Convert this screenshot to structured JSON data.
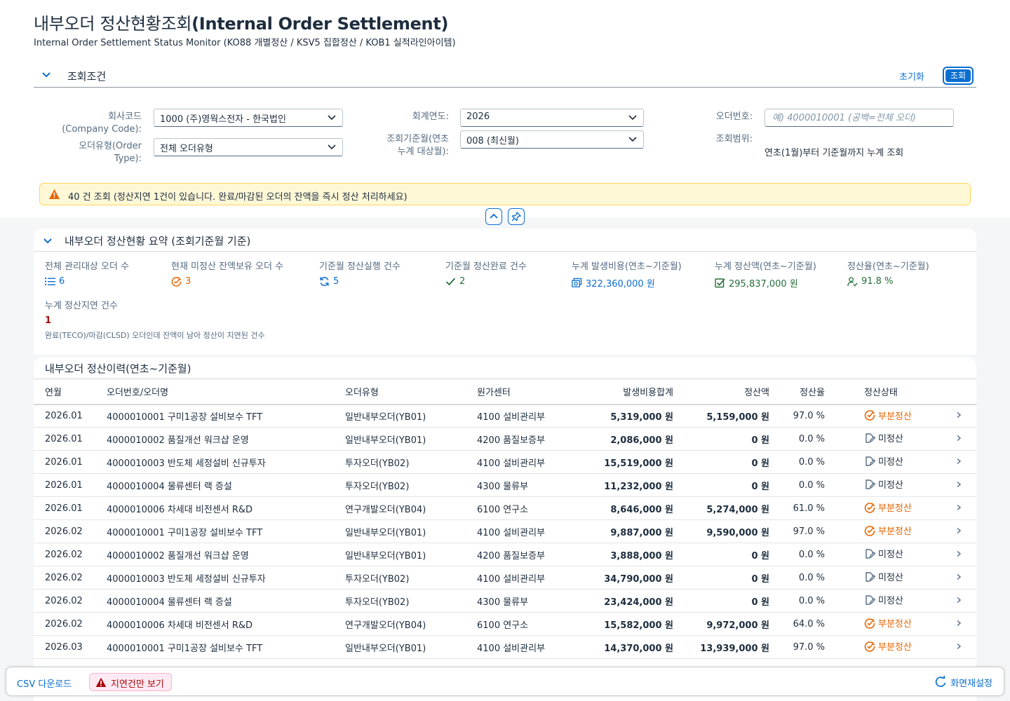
{
  "header": {
    "title_ko": "내부오더 정산현황조회",
    "title_en": "(Internal Order Settlement)",
    "subtitle": "Internal Order Settlement Status Monitor (KO88 개별정산 / KSV5 집합정산 / KOB1 실적라인아이템)"
  },
  "conditions": {
    "title": "조회조건",
    "reset_label": "초기화",
    "search_label": "조회",
    "company_code_label": "회사코드\n(Company Code):",
    "company_code_value": "1000 (주)영웍스전자 - 한국법인",
    "order_type_label": "오더유형(Order\nType):",
    "order_type_value": "전체 오더유형",
    "fiscal_year_label": "회계연도:",
    "fiscal_year_value": "2026",
    "period_label": "조회기준월(연초\n누계 대상월):",
    "period_value": "008 (최신월)",
    "order_no_label": "오더번호:",
    "order_no_placeholder": "예) 4000010001 (공백=전체 오더)",
    "scope_label": "조회범위:",
    "scope_value": "연초(1월)부터 기준월까지 누계 조회"
  },
  "message": {
    "text": "40 건 조회 (정산지연 1건이 있습니다. 완료/마감된 오더의 잔액을 즉시 정산 처리하세요)"
  },
  "summary": {
    "title": "내부오더 정산현황 요약 (조회기준월 기준)",
    "kpis": [
      {
        "label": "전체 관리대상 오더 수",
        "value": "6",
        "icon": "list-icon",
        "color": "#0a6ed1"
      },
      {
        "label": "현재 미정산 잔액보유 오더 수",
        "value": "3",
        "icon": "partial-settle-icon",
        "color": "#e76500"
      },
      {
        "label": "기준월 정산실행 건수",
        "value": "5",
        "icon": "refresh-icon",
        "color": "#0a6ed1"
      },
      {
        "label": "기준월 정산완료 건수",
        "value": "2",
        "icon": "check-icon",
        "color": "#256f3a"
      },
      {
        "label": "누계 발생비용(연초~기준월)",
        "value": "322,360,000 원",
        "icon": "money-icon",
        "color": "#0a6ed1"
      },
      {
        "label": "누계 정산액(연초~기준월)",
        "value": "295,837,000 원",
        "icon": "checkbox-icon",
        "color": "#256f3a"
      },
      {
        "label": "정산율(연초~기준월)",
        "value": "91.8 %",
        "icon": "person-check-icon",
        "color": "#256f3a"
      }
    ],
    "delay": {
      "label": "누계 정산지연 건수",
      "value": "1",
      "note": "완료(TECO)/마감(CLSD) 오더인데 잔액이 남아 정산이 지연된 건수"
    }
  },
  "table": {
    "title": "내부오더 정산이력(연초~기준월)",
    "columns": [
      "연월",
      "오더번호/오더명",
      "오더유형",
      "원가센터",
      "발생비용합계",
      "정산액",
      "정산율",
      "정산상태"
    ],
    "rows": [
      {
        "ym": "2026.01",
        "order": "4000010001 구미1공장 설비보수 TFT",
        "type": "일반내부오더(YB01)",
        "cc": "4100 설비관리부",
        "amount": "5,319,000 원",
        "settled": "5,159,000 원",
        "rate": "97.0 %",
        "status": "부분정산",
        "kind": "partial"
      },
      {
        "ym": "2026.01",
        "order": "4000010002 품질개선 워크샵 운영",
        "type": "일반내부오더(YB01)",
        "cc": "4200 품질보증부",
        "amount": "2,086,000 원",
        "settled": "0 원",
        "rate": "0.0 %",
        "status": "미정산",
        "kind": "none"
      },
      {
        "ym": "2026.01",
        "order": "4000010003 반도체 세정설비 신규투자",
        "type": "투자오더(YB02)",
        "cc": "4100 설비관리부",
        "amount": "15,519,000 원",
        "settled": "0 원",
        "rate": "0.0 %",
        "status": "미정산",
        "kind": "none"
      },
      {
        "ym": "2026.01",
        "order": "4000010004 물류센터 랙 증설",
        "type": "투자오더(YB02)",
        "cc": "4300 물류부",
        "amount": "11,232,000 원",
        "settled": "0 원",
        "rate": "0.0 %",
        "status": "미정산",
        "kind": "none"
      },
      {
        "ym": "2026.01",
        "order": "4000010006 차세대 비전센서 R&D",
        "type": "연구개발오더(YB04)",
        "cc": "6100 연구소",
        "amount": "8,646,000 원",
        "settled": "5,274,000 원",
        "rate": "61.0 %",
        "status": "부분정산",
        "kind": "partial"
      },
      {
        "ym": "2026.02",
        "order": "4000010001 구미1공장 설비보수 TFT",
        "type": "일반내부오더(YB01)",
        "cc": "4100 설비관리부",
        "amount": "9,887,000 원",
        "settled": "9,590,000 원",
        "rate": "97.0 %",
        "status": "부분정산",
        "kind": "partial"
      },
      {
        "ym": "2026.02",
        "order": "4000010002 품질개선 워크샵 운영",
        "type": "일반내부오더(YB01)",
        "cc": "4200 품질보증부",
        "amount": "3,888,000 원",
        "settled": "0 원",
        "rate": "0.0 %",
        "status": "미정산",
        "kind": "none"
      },
      {
        "ym": "2026.02",
        "order": "4000010003 반도체 세정설비 신규투자",
        "type": "투자오더(YB02)",
        "cc": "4100 설비관리부",
        "amount": "34,790,000 원",
        "settled": "0 원",
        "rate": "0.0 %",
        "status": "미정산",
        "kind": "none"
      },
      {
        "ym": "2026.02",
        "order": "4000010004 물류센터 랙 증설",
        "type": "투자오더(YB02)",
        "cc": "4300 물류부",
        "amount": "23,424,000 원",
        "settled": "0 원",
        "rate": "0.0 %",
        "status": "미정산",
        "kind": "none"
      },
      {
        "ym": "2026.02",
        "order": "4000010006 차세대 비전센서 R&D",
        "type": "연구개발오더(YB04)",
        "cc": "6100 연구소",
        "amount": "15,582,000 원",
        "settled": "9,972,000 원",
        "rate": "64.0 %",
        "status": "부분정산",
        "kind": "partial"
      },
      {
        "ym": "2026.03",
        "order": "4000010001 구미1공장 설비보수 TFT",
        "type": "일반내부오더(YB01)",
        "cc": "4100 설비관리부",
        "amount": "14,370,000 원",
        "settled": "13,939,000 원",
        "rate": "97.0 %",
        "status": "부분정산",
        "kind": "partial"
      }
    ]
  },
  "footer": {
    "csv_label": "CSV 다운로드",
    "delay_only_label": "지연건만 보기",
    "reset_layout_label": "화면재설정"
  },
  "colors": {
    "accent": "#0a6ed1",
    "partial": "#e76500",
    "positive": "#256f3a",
    "critical": "#aa0808",
    "warning_bg": "#fff8d6"
  }
}
